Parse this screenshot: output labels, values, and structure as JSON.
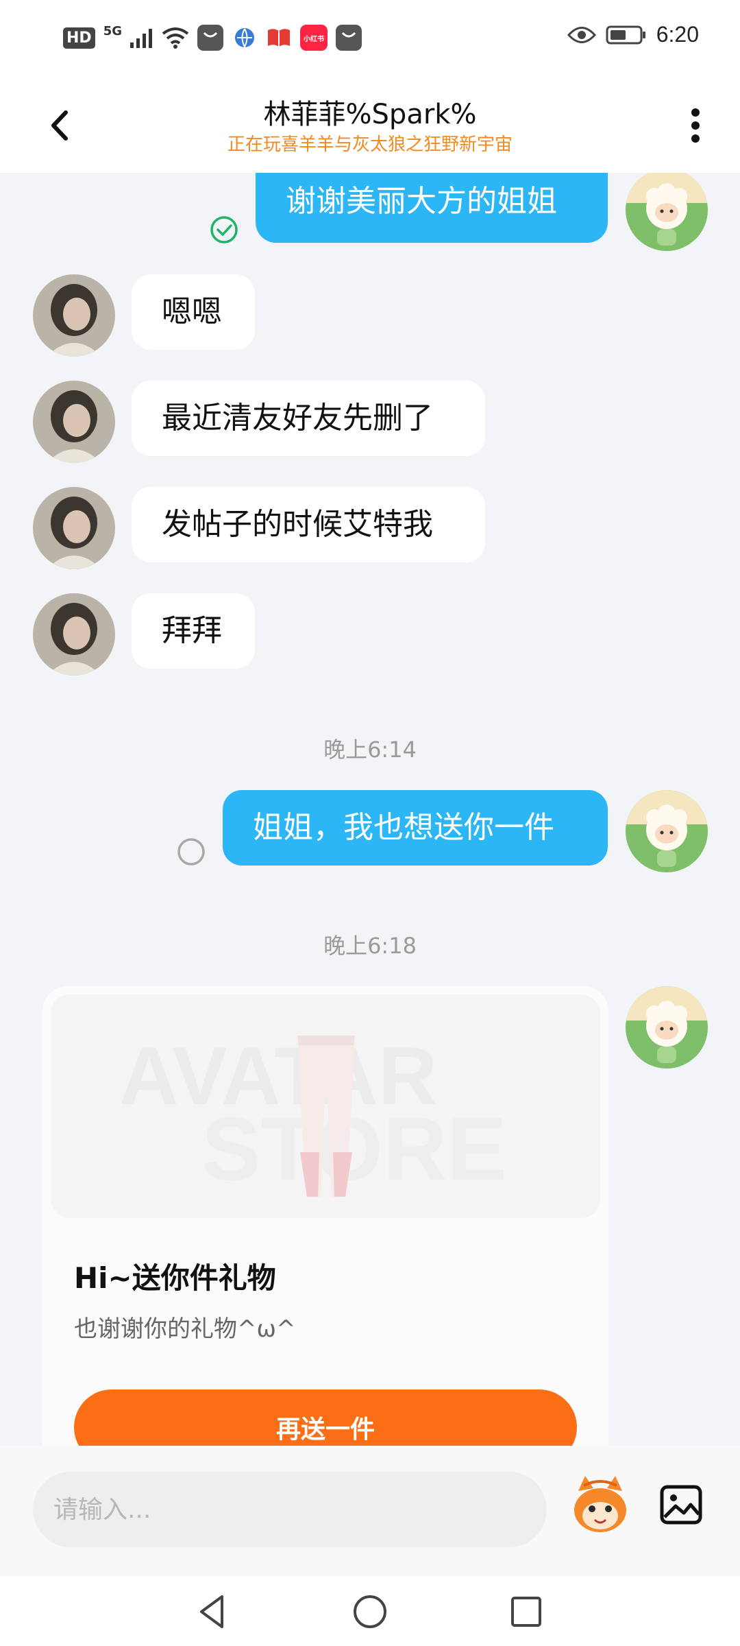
{
  "status_bar": {
    "hd_label": "HD",
    "network_label": "5G",
    "time": "6:20",
    "icons": [
      "signal-icon",
      "wifi-icon",
      "app-notification-icon",
      "browser-icon",
      "book-icon",
      "xiaohongshu-icon",
      "app-notification-icon",
      "eye-icon",
      "battery-icon"
    ],
    "xiaohongshu_label": "小红书"
  },
  "header": {
    "title": "林菲菲%Spark%",
    "subtitle": "正在玩喜羊羊与灰太狼之狂野新宇宙",
    "accent_color": "#f28a1e"
  },
  "messages": [
    {
      "direction": "out",
      "text": "谢谢美丽大方的姐姐",
      "status": "read"
    },
    {
      "direction": "in",
      "text": "嗯嗯"
    },
    {
      "direction": "in",
      "text": "最近清友好友先删了"
    },
    {
      "direction": "in",
      "text": "发帖子的时候艾特我"
    },
    {
      "direction": "in",
      "text": "拜拜"
    },
    {
      "type": "time",
      "text": "晚上6:14"
    },
    {
      "direction": "out",
      "text": "姐姐，我也想送你一件",
      "status": "sent"
    },
    {
      "type": "time",
      "text": "晚上6:18"
    }
  ],
  "gift_card": {
    "watermark_line1": "AVATAR",
    "watermark_line2": "STORE",
    "title": "Hi~送你件礼物",
    "description": "也谢谢你的礼物^ω^",
    "button_label": "再送一件",
    "button_color": "#fa6e16"
  },
  "input_bar": {
    "placeholder": "请输入..."
  },
  "colors": {
    "outgoing_bubble": "#2db6f5",
    "incoming_bubble": "#ffffff",
    "chat_background": "#f2f4f8"
  }
}
